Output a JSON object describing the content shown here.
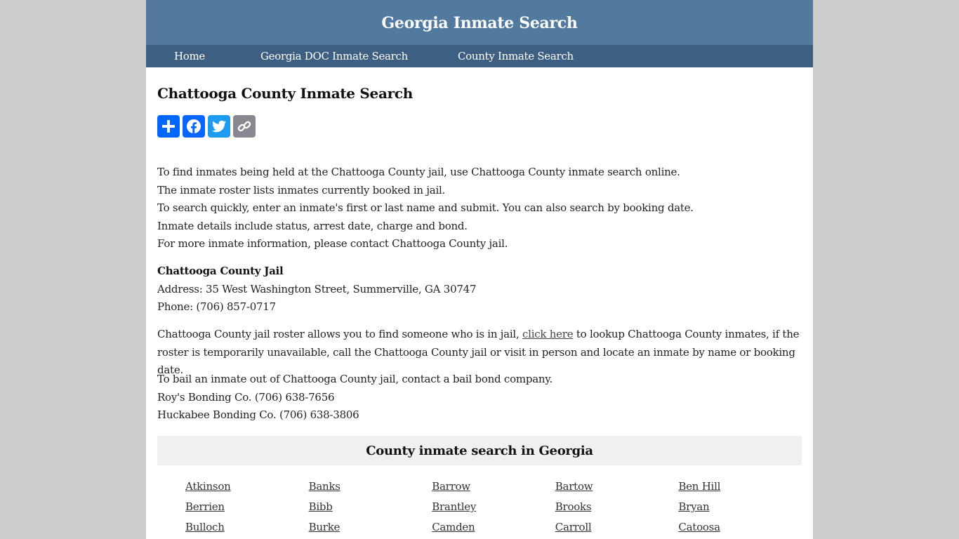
{
  "site": {
    "title": "Georgia Inmate Search"
  },
  "nav": {
    "items": [
      {
        "label": "Home"
      },
      {
        "label": "Georgia DOC Inmate Search"
      },
      {
        "label": "County Inmate Search"
      }
    ]
  },
  "page": {
    "heading": "Chattooga County Inmate Search"
  },
  "share": {
    "buttons": [
      {
        "name": "share",
        "icon": "plus-icon",
        "color": "#0166ff"
      },
      {
        "name": "facebook",
        "icon": "facebook-icon",
        "color": "#0866ff"
      },
      {
        "name": "twitter",
        "icon": "twitter-icon",
        "color": "#1d9bf0"
      },
      {
        "name": "copy-link",
        "icon": "link-icon",
        "color": "#888990"
      }
    ]
  },
  "intro": {
    "lines": [
      "To find inmates being held at the Chattooga County jail, use Chattooga County inmate search online.",
      "The inmate roster lists inmates currently booked in jail.",
      "To search quickly, enter an inmate's first or last name and submit. You can also search by booking date.",
      "Inmate details include status, arrest date, charge and bond.",
      "For more inmate information, please contact Chattooga County jail."
    ]
  },
  "jail": {
    "name": "Chattooga County Jail",
    "address": "Address: 35 West Washington Street, Summerville, GA 30747",
    "phone": "Phone: (706) 857-0717"
  },
  "roster": {
    "before_link": "Chattooga County jail roster allows you to find someone who is in jail, ",
    "link_text": "click here",
    "after_link": " to lookup Chattooga County inmates, if the roster is temporarily unavailable, call the Chattooga County jail or visit in person and locate an inmate by name or booking date."
  },
  "bail": {
    "intro": "To bail an inmate out of Chattooga County jail, contact a bail bond company.",
    "companies": [
      "Roy's Bonding Co. (706) 638-7656",
      "Huckabee Bonding Co. (706) 638-3806"
    ]
  },
  "counties": {
    "heading": "County inmate search in Georgia",
    "items": [
      "Atkinson",
      "Banks",
      "Barrow",
      "Bartow",
      "Ben Hill",
      "Berrien",
      "Bibb",
      "Brantley",
      "Brooks",
      "Bryan",
      "Bulloch",
      "Burke",
      "Camden",
      "Carroll",
      "Catoosa"
    ]
  }
}
